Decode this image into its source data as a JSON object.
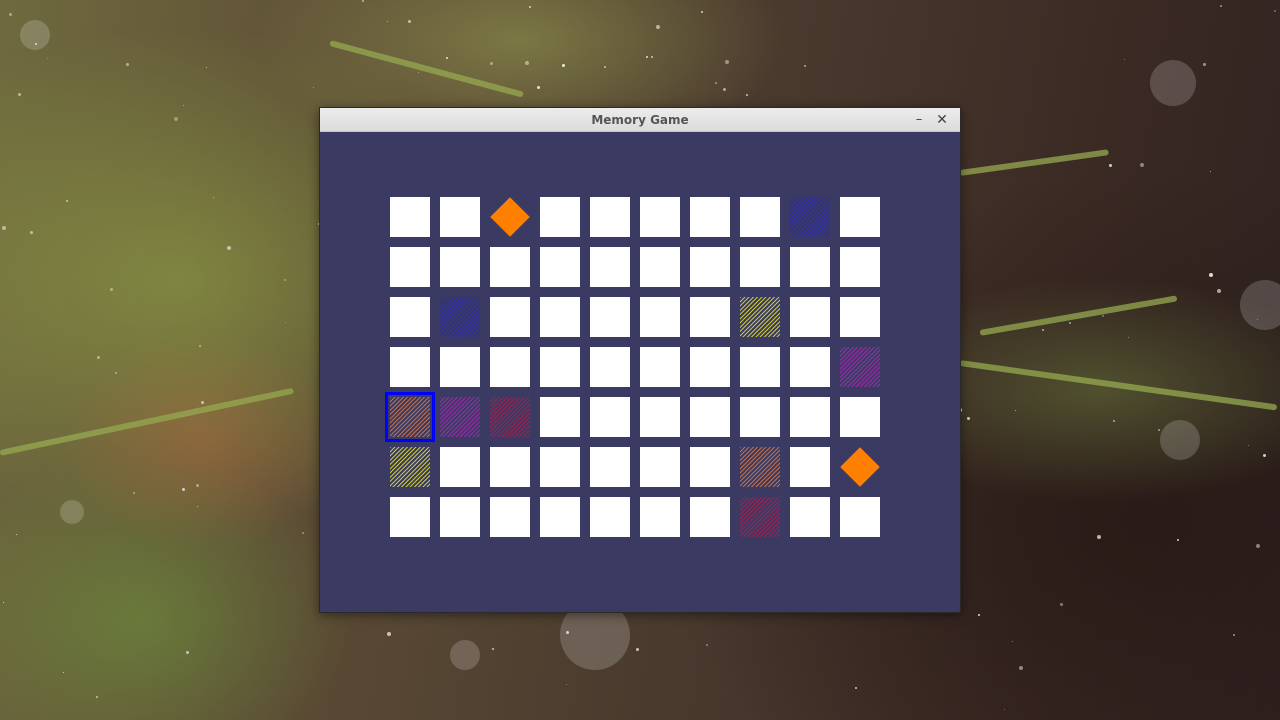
{
  "window": {
    "title": "Memory Game",
    "minimize_glyph": "–",
    "close_glyph": "✕",
    "background_color": "#3b3a63"
  },
  "board": {
    "columns": 10,
    "rows": 7,
    "hidden_card_color": "#ffffff",
    "selection_color": "#0000ff",
    "selected_card": {
      "row": 4,
      "col": 0
    },
    "revealed_cards": [
      {
        "row": 0,
        "col": 2,
        "shape": "diamond",
        "color": "#ff8000"
      },
      {
        "row": 0,
        "col": 8,
        "shape": "lines",
        "color": "#2a2aaa"
      },
      {
        "row": 2,
        "col": 1,
        "shape": "lines",
        "color": "#2a2aaa"
      },
      {
        "row": 2,
        "col": 7,
        "shape": "lines",
        "color": "#c8c83c"
      },
      {
        "row": 3,
        "col": 9,
        "shape": "lines",
        "color": "#9a2aaa"
      },
      {
        "row": 4,
        "col": 0,
        "shape": "lines",
        "color": "#c0704a"
      },
      {
        "row": 4,
        "col": 1,
        "shape": "lines",
        "color": "#9a2aaa"
      },
      {
        "row": 4,
        "col": 2,
        "shape": "lines",
        "color": "#a02050"
      },
      {
        "row": 5,
        "col": 0,
        "shape": "lines",
        "color": "#c8c83c"
      },
      {
        "row": 5,
        "col": 7,
        "shape": "lines",
        "color": "#c0704a"
      },
      {
        "row": 5,
        "col": 9,
        "shape": "diamond",
        "color": "#ff8000"
      },
      {
        "row": 6,
        "col": 7,
        "shape": "lines",
        "color": "#a02050"
      }
    ]
  }
}
